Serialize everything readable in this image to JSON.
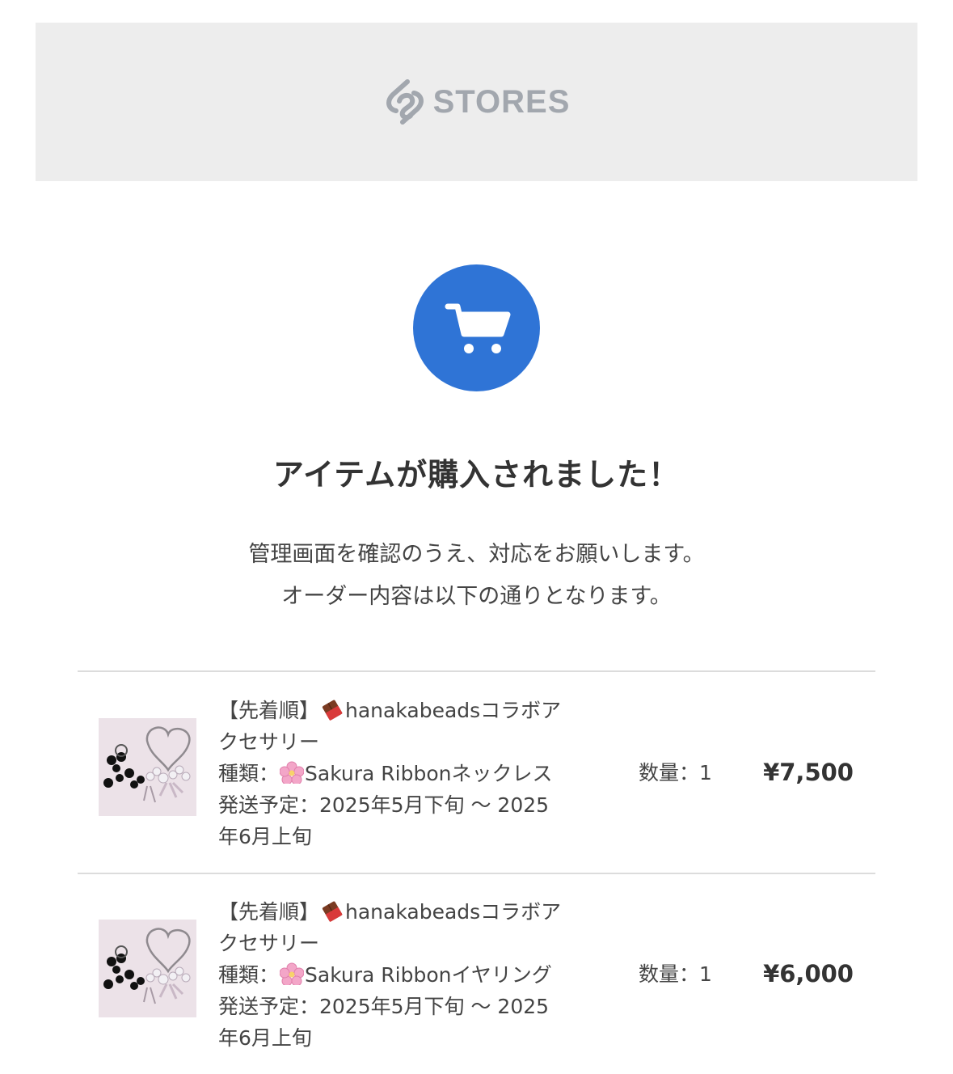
{
  "header": {
    "logo_text": "STORES",
    "logo_icon": "stores-logo-icon",
    "background": "#ededed"
  },
  "hero": {
    "icon": "shopping-cart-icon",
    "icon_color": "#2f74d6",
    "title": "アイテムが購入されました！",
    "message_line1": "管理画面を確認のうえ、対応をお願いします。",
    "message_line2": "オーダー内容は以下の通りとなります。"
  },
  "order_items": [
    {
      "name_prefix": "【先着順】",
      "name_emoji": "chocolate-bar-icon",
      "name_suffix": "hanakabeadsコラボア",
      "name_line2": "クセサリー",
      "type_prefix": "種類：",
      "type_emoji": "cherry-blossom-icon",
      "type_value": "Sakura Ribbonネックレス",
      "shipping_line1": "発送予定：2025年5月下旬 〜 2025",
      "shipping_line2": "年6月上旬",
      "quantity": "数量：1",
      "price": "¥7,500",
      "thumbnail": "necklace-product-image"
    },
    {
      "name_prefix": "【先着順】",
      "name_emoji": "chocolate-bar-icon",
      "name_suffix": "hanakabeadsコラボア",
      "name_line2": "クセサリー",
      "type_prefix": "種類：",
      "type_emoji": "cherry-blossom-icon",
      "type_value": "Sakura Ribbonイヤリング",
      "shipping_line1": "発送予定：2025年5月下旬 〜 2025",
      "shipping_line2": "年6月上旬",
      "quantity": "数量：1",
      "price": "¥6,000",
      "thumbnail": "earrings-product-image"
    }
  ]
}
